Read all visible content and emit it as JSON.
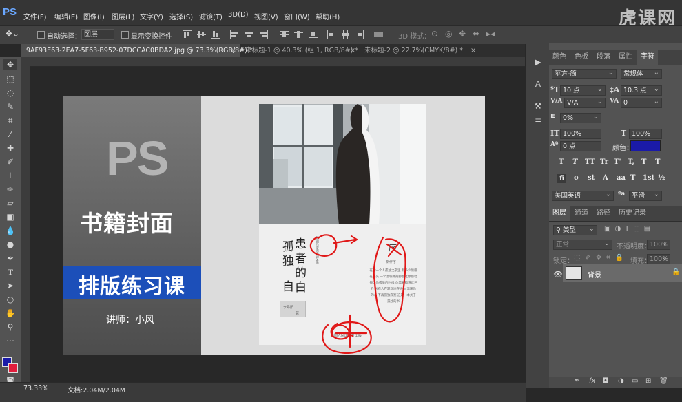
{
  "app": {
    "logo": "PS",
    "watermark": "虎课网"
  },
  "menu": [
    "文件(F)",
    "编辑(E)",
    "图像(I)",
    "图层(L)",
    "文字(Y)",
    "选择(S)",
    "滤镜(T)",
    "3D(D)",
    "视图(V)",
    "窗口(W)",
    "帮助(H)"
  ],
  "options": {
    "auto_select_label": "自动选择：",
    "auto_select_value": "图层",
    "show_transform_label": "显示变换控件",
    "mode_3d_label": "3D 模式："
  },
  "tabs": [
    {
      "label": "9AF93E63-2EA7-5F63-B952-07DCCAC0BDA2.jpg @ 73.3%(RGB/8#) *",
      "active": true
    },
    {
      "label": "未标题-1 @ 40.3% (组 1, RGB/8#) *",
      "active": false
    },
    {
      "label": "未标题-2 @ 22.7%(CMYK/8#) *",
      "active": false
    }
  ],
  "doc": {
    "ps": "PS",
    "title": "书籍封面",
    "banner": "排版练习课",
    "teacher": "讲师：小风",
    "cover": {
      "title_left": "孤独",
      "title_right": "患者的白",
      "title_mid": "自",
      "author": "李丹阳",
      "author_suffix": "著",
      "preface": "序",
      "preface_sub": "新作序",
      "publisher": "中国人民出版社出版",
      "small_vertical": "新锐作家原创文集",
      "preface_body": "在你一个人孤独之夜里 有多少情感在心头 一个温暖拥抱都会让你感动 每当你孤单的时候 你需要知道这世界 总有人在默默地守护你 温暖你的心 不再孤独寂寞 这是一本关于孤独的书"
    }
  },
  "right_panel": {
    "top_tabs": [
      "颜色",
      "色板",
      "段落",
      "属性",
      "字符"
    ],
    "font_family": "苹方-简",
    "font_style": "常规体",
    "font_size": "10 点",
    "leading": "10.3 点",
    "kerning": "V/A",
    "tracking": "0",
    "scale_percent": "0%",
    "vscale": "100%",
    "hscale": "100%",
    "baseline": "0 点",
    "color_label": "颜色：",
    "color_value": "#1a1aa8",
    "type_buttons": [
      "T",
      "T",
      "TT",
      "Tr",
      "T'",
      "T,",
      "T",
      "T"
    ],
    "opentype_buttons": [
      "fi",
      "σ",
      "st",
      "A",
      "aa",
      "T",
      "1st",
      "½"
    ],
    "language": "美国英语",
    "antialias": "平滑",
    "layer_tabs": [
      "图层",
      "通道",
      "路径",
      "历史记录"
    ],
    "layer_filter": "类型",
    "blend_mode": "正常",
    "opacity_label": "不透明度：",
    "opacity_value": "100%",
    "lock_label": "锁定：",
    "fill_label": "填充：",
    "fill_value": "100%",
    "layer_name": "背景"
  },
  "status": {
    "zoom": "73.33%",
    "doc": "文档:2.04M/2.04M"
  }
}
